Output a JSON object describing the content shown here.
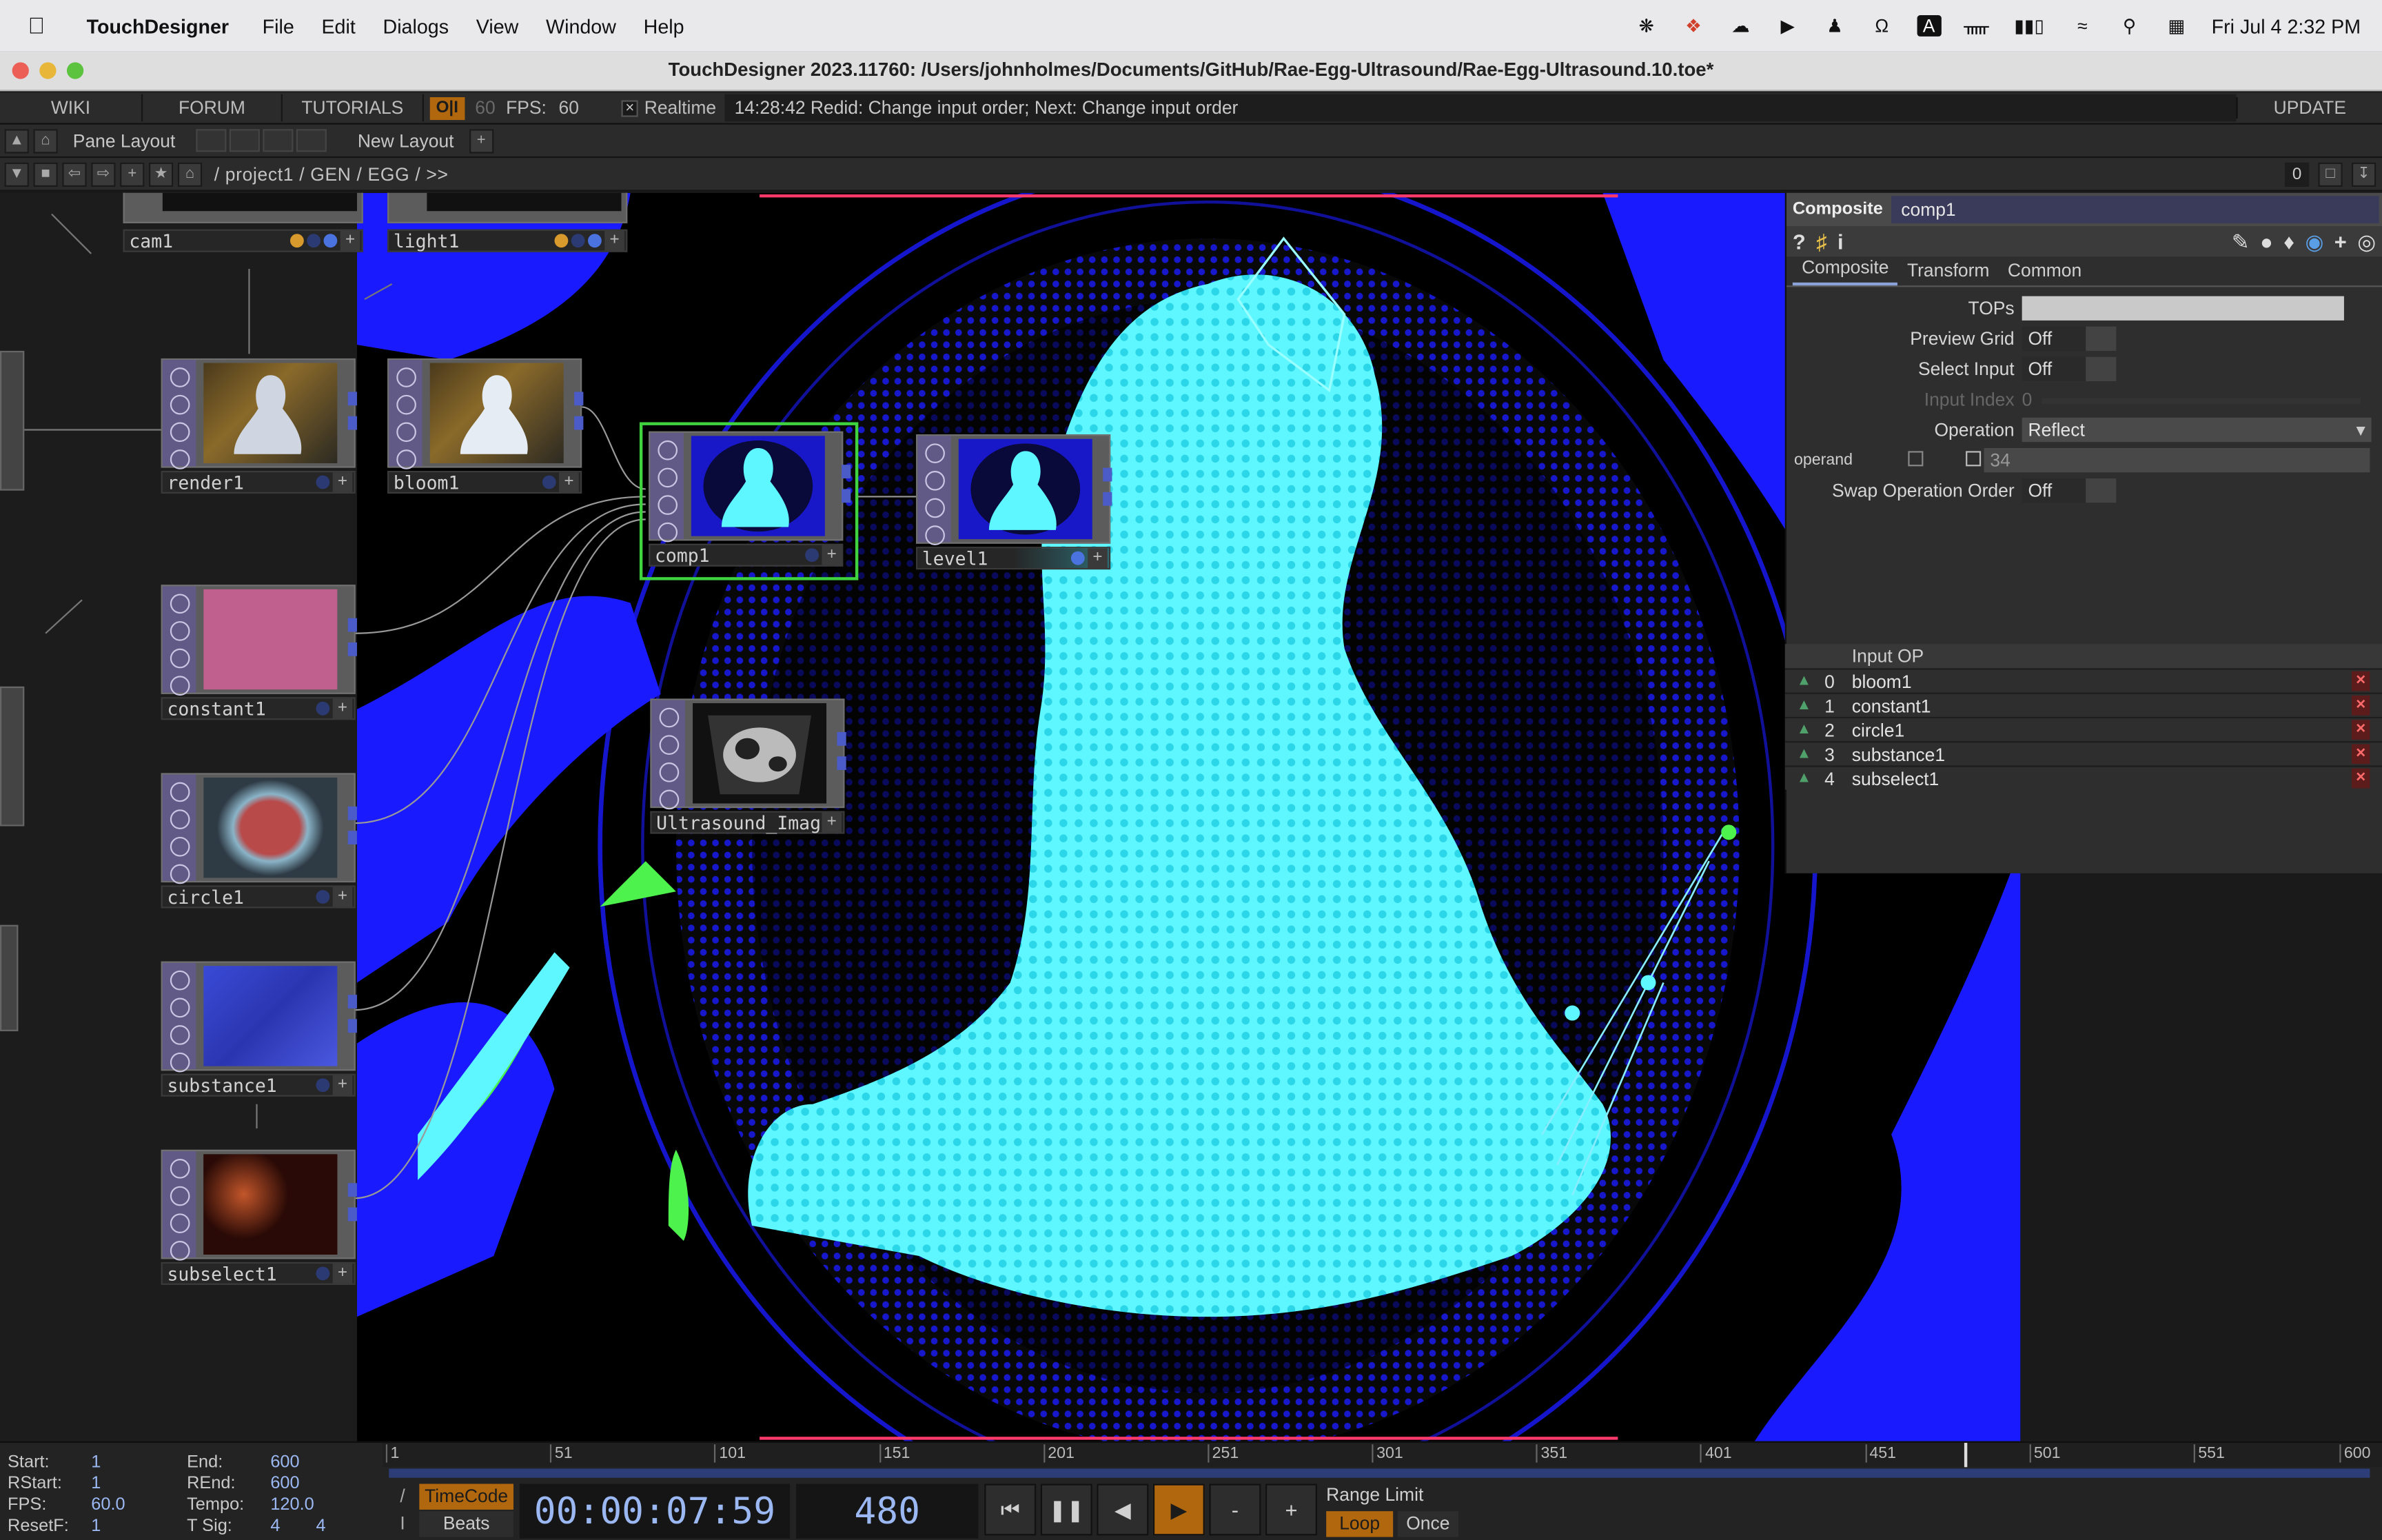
{
  "menubar": {
    "app": "TouchDesigner",
    "items": [
      "File",
      "Edit",
      "Dialogs",
      "View",
      "Window",
      "Help"
    ],
    "datetime": "Fri Jul 4  2:32 PM",
    "status_icons": [
      "openai-icon",
      "dropbox-icon",
      "cloud-icon",
      "play-icon",
      "figure-icon",
      "headphones-icon",
      "keyboard-a-icon",
      "bluetooth-icon",
      "battery-icon",
      "wifi-icon",
      "search-icon",
      "control-center-icon"
    ]
  },
  "window": {
    "title": "TouchDesigner 2023.11760: /Users/johnholmes/Documents/GitHub/Rae-Egg-Ultrasound/Rae-Egg-Ultrasound.10.toe*"
  },
  "topbar": {
    "wiki": "WIKI",
    "forum": "FORUM",
    "tutorials": "TUTORIALS",
    "oi": "O|I",
    "fps_target": "60",
    "fps_label": "FPS:",
    "fps_value": "60",
    "realtime_label": "Realtime",
    "status": "14:28:42 Redid: Change input order; Next: Change input order",
    "update": "UPDATE"
  },
  "layoutbar": {
    "pane_layout": "Pane Layout",
    "new_layout": "New Layout",
    "plus": "+"
  },
  "pathbar": {
    "path": "/ project1 / GEN / EGG / >>",
    "zero": "0"
  },
  "nodes": {
    "cam1": "cam1",
    "light1": "light1",
    "render1": "render1",
    "bloom1": "bloom1",
    "comp1": "comp1",
    "level1": "level1",
    "constant1": "constant1",
    "circle1": "circle1",
    "ultrasound": "Ultrasound_Image",
    "substance1": "substance1",
    "subselect1": "subselect1"
  },
  "params": {
    "type": "Composite",
    "name": "comp1",
    "tabs": [
      "Composite",
      "Transform",
      "Common"
    ],
    "tops_label": "TOPs",
    "preview_grid_label": "Preview Grid",
    "preview_grid_value": "Off",
    "select_input_label": "Select Input",
    "select_input_value": "Off",
    "input_index_label": "Input Index",
    "input_index_value": "0",
    "operation_label": "Operation",
    "operation_value": "Reflect",
    "operand_label": "operand",
    "operand_value": "34",
    "swap_label": "Swap Operation Order",
    "swap_value": "Off"
  },
  "inputs": {
    "header": "Input OP",
    "rows": [
      {
        "index": "0",
        "op": "bloom1"
      },
      {
        "index": "1",
        "op": "constant1"
      },
      {
        "index": "2",
        "op": "circle1"
      },
      {
        "index": "3",
        "op": "substance1"
      },
      {
        "index": "4",
        "op": "subselect1"
      }
    ]
  },
  "timeline": {
    "start_label": "Start:",
    "start": "1",
    "end_label": "End:",
    "end": "600",
    "rstart_label": "RStart:",
    "rstart": "1",
    "rend_label": "REnd:",
    "rend": "600",
    "fps_label": "FPS:",
    "fps": "60.0",
    "tempo_label": "Tempo:",
    "tempo": "120.0",
    "resetf_label": "ResetF:",
    "resetf": "1",
    "tsig_label": "T Sig:",
    "tsig_a": "4",
    "tsig_b": "4",
    "ruler": [
      "1",
      "51",
      "101",
      "151",
      "201",
      "251",
      "301",
      "351",
      "401",
      "451",
      "501",
      "551",
      "600"
    ],
    "timecode_btn": "TimeCode",
    "beats_btn": "Beats",
    "timecode": "00:00:07:59",
    "frame": "480",
    "playhead_frame": 480,
    "range_limit": "Range Limit",
    "loop": "Loop",
    "once": "Once",
    "minus": "-",
    "plus": "+"
  },
  "colors": {
    "accent_orange": "#b0670d",
    "viewer_blue": "#1a1aff",
    "viewer_cyan": "#5ff7ff",
    "selected_green": "#3fd43f",
    "op_purple": "#615a86"
  }
}
